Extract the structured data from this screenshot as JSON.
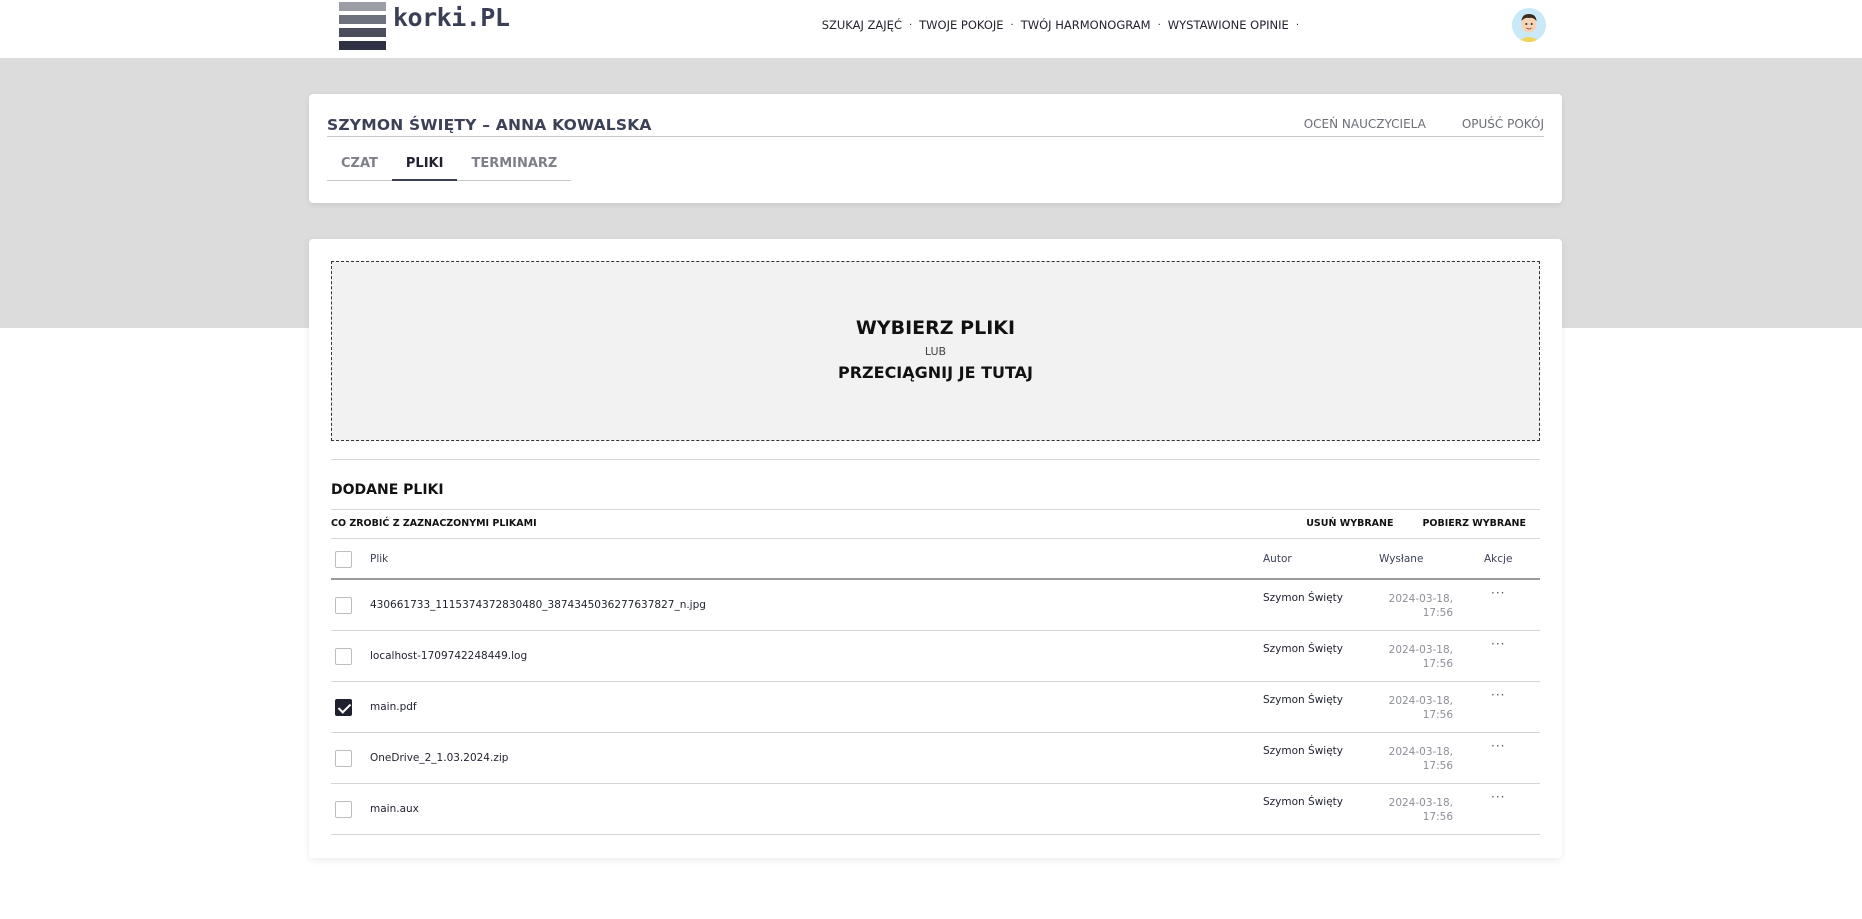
{
  "header": {
    "logo_text": "korki.PL",
    "nav": [
      "SZUKAJ ZAJĘĆ",
      "TWOJE POKOJE",
      "TWÓJ HARMONOGRAM",
      "WYSTAWIONE OPINIE"
    ],
    "nav_separator": "·",
    "colors": {
      "logo_bar_1": "#9b9da6",
      "logo_bar_2": "#6e717e",
      "logo_bar_3": "#4a4d5c",
      "logo_bar_4": "#2f3244",
      "avatar_bg": "#c9e9f8"
    }
  },
  "room": {
    "title": "SZYMON ŚWIĘTY – ANNA KOWALSKA",
    "actions": [
      "OCEŃ NAUCZYCIELA",
      "OPUŚĆ POKÓJ"
    ],
    "tabs": [
      {
        "label": "CZAT",
        "active": false
      },
      {
        "label": "PLIKI",
        "active": true
      },
      {
        "label": "TERMINARZ",
        "active": false
      }
    ]
  },
  "upload": {
    "choose": "WYBIERZ PLIKI",
    "or": "LUB",
    "drag": "PRZECIĄGNIJ JE TUTAJ"
  },
  "files": {
    "title": "DODANE PLIKI",
    "bulk_label": "CO ZROBIĆ Z ZAZNACZONYMI PLIKAMI",
    "bulk_actions": [
      "USUŃ WYBRANE",
      "POBIERZ WYBRANE"
    ],
    "columns": {
      "file": "Plik",
      "author": "Autor",
      "sent": "Wysłane",
      "actions": "Akcje"
    },
    "menu_glyph": "···",
    "rows": [
      {
        "name": "430661733_1115374372830480_3874345036277637827_n.jpg",
        "author": "Szymon Święty",
        "date": "2024-03-18,",
        "time": "17:56",
        "checked": false
      },
      {
        "name": "localhost-1709742248449.log",
        "author": "Szymon Święty",
        "date": "2024-03-18,",
        "time": "17:56",
        "checked": false
      },
      {
        "name": "main.pdf",
        "author": "Szymon Święty",
        "date": "2024-03-18,",
        "time": "17:56",
        "checked": true
      },
      {
        "name": "OneDrive_2_1.03.2024.zip",
        "author": "Szymon Święty",
        "date": "2024-03-18,",
        "time": "17:56",
        "checked": false
      },
      {
        "name": "main.aux",
        "author": "Szymon Święty",
        "date": "2024-03-18,",
        "time": "17:56",
        "checked": false
      }
    ]
  }
}
